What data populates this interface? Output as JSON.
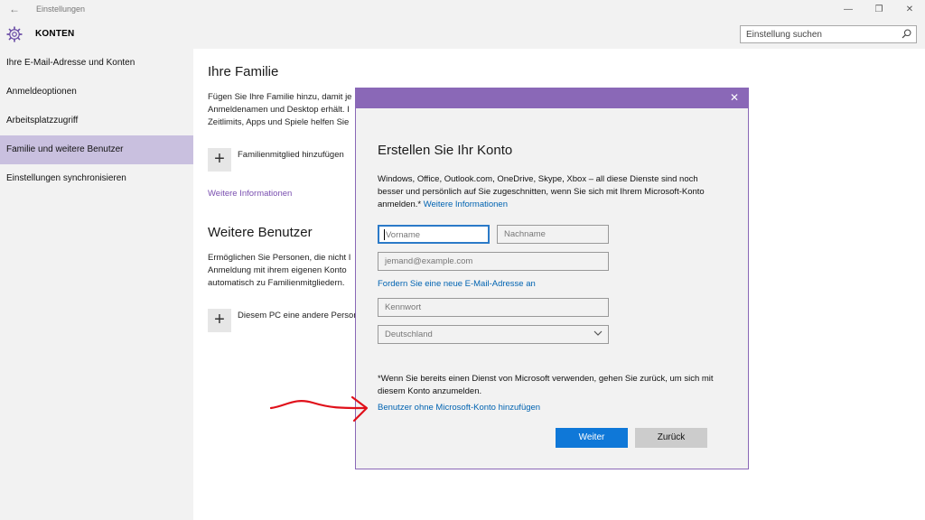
{
  "window": {
    "title": "Einstellungen",
    "back_icon": "←",
    "controls": [
      "—",
      "❐",
      "✕"
    ]
  },
  "header": {
    "icon": "gear-icon",
    "title": "KONTEN",
    "search_placeholder": "Einstellung suchen"
  },
  "sidebar": {
    "items": [
      {
        "label": "Ihre E-Mail-Adresse und Konten",
        "active": false
      },
      {
        "label": "Anmeldeoptionen",
        "active": false
      },
      {
        "label": "Arbeitsplatzzugriff",
        "active": false
      },
      {
        "label": "Familie und weitere Benutzer",
        "active": true
      },
      {
        "label": "Einstellungen synchronisieren",
        "active": false
      }
    ]
  },
  "main": {
    "family": {
      "heading": "Ihre Familie",
      "text_lines": [
        "Fügen Sie Ihre Familie hinzu, damit je",
        "Anmeldenamen und Desktop erhält. I",
        "Zeitlimits, Apps und Spiele helfen Sie"
      ],
      "add_label": "Familienmitglied hinzufügen",
      "more_info": "Weitere Informationen"
    },
    "others": {
      "heading": "Weitere Benutzer",
      "text_lines": [
        "Ermöglichen Sie Personen, die nicht I",
        "Anmeldung mit ihrem eigenen Konto",
        "automatisch zu Familienmitgliedern."
      ],
      "add_label": "Diesem PC eine andere Person"
    }
  },
  "dialog": {
    "close": "✕",
    "title": "Erstellen Sie Ihr Konto",
    "description": "Windows, Office, Outlook.com, OneDrive, Skype, Xbox – all diese Dienste sind noch besser und persönlich auf Sie zugeschnitten, wenn Sie sich mit Ihrem Microsoft-Konto anmelden.*",
    "description_link": "Weitere Informationen",
    "firstname_placeholder": "Vorname",
    "lastname_placeholder": "Nachname",
    "email_placeholder": "jemand@example.com",
    "new_email_link": "Fordern Sie eine neue E-Mail-Adresse an",
    "password_placeholder": "Kennwort",
    "country_value": "Deutschland",
    "note": "*Wenn Sie bereits einen Dienst von Microsoft verwenden, gehen Sie zurück, um sich mit diesem Konto anzumelden.",
    "no_account_link": "Benutzer ohne Microsoft-Konto hinzufügen",
    "next_button": "Weiter",
    "back_button": "Zurück"
  },
  "colors": {
    "accent": "#8a68b7",
    "selection": "#c9c0df",
    "link": "#0063b1",
    "primary_button": "#0f78d8",
    "annotation_arrow": "#e0101a"
  }
}
